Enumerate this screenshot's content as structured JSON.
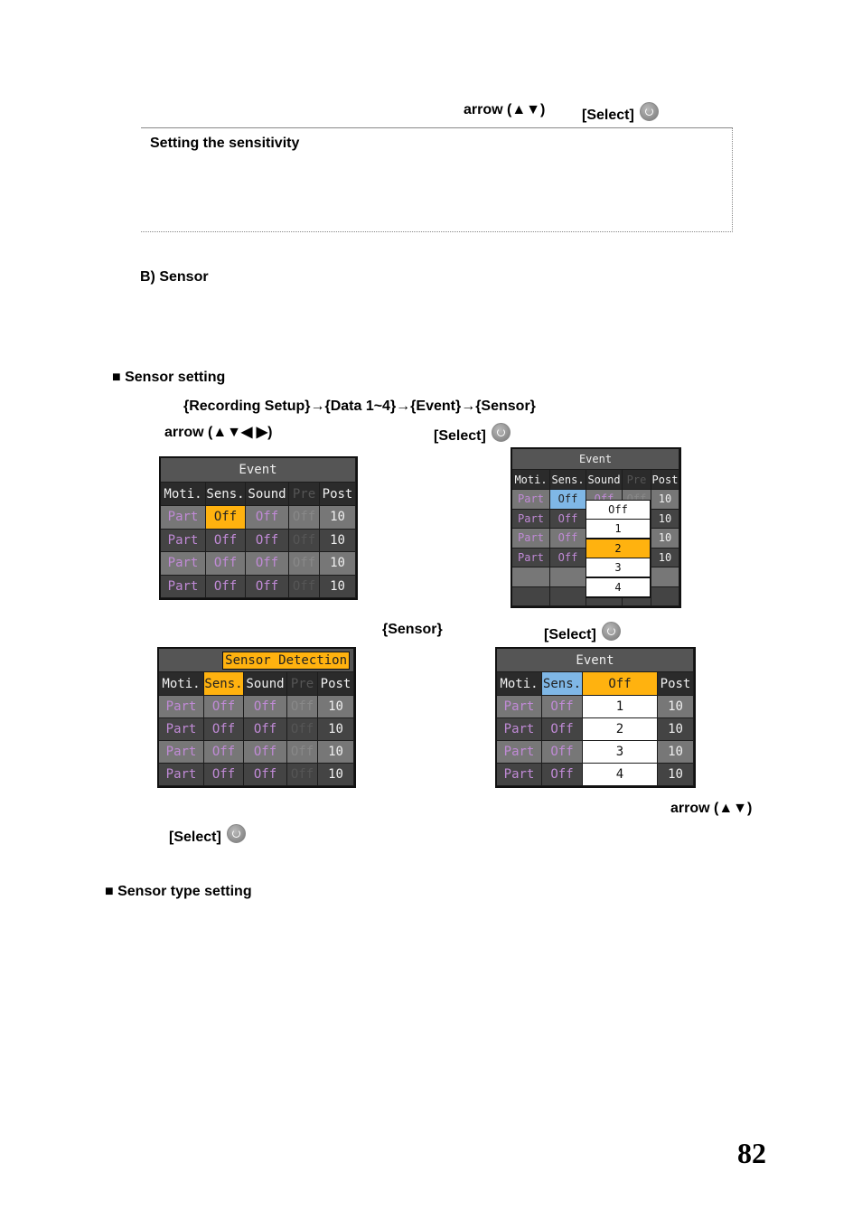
{
  "header": {
    "arrow": "arrow (▲▼)",
    "select": "[Select]"
  },
  "box_title": "Setting the sensitivity",
  "section_b": "B) Sensor",
  "sensor_setting": {
    "title": "■ Sensor setting",
    "path": "{Recording Setup}→{Data 1~4}→{Event}→{Sensor}",
    "arrow": "arrow (▲▼◀ ▶)",
    "select": "[Select]"
  },
  "mid": {
    "sensor": "{Sensor}",
    "select": "[Select]"
  },
  "bottom": {
    "arrow": "arrow (▲▼)",
    "select": "[Select]"
  },
  "sensor_type_title": "■ Sensor type setting",
  "page_number": "82",
  "colors": {
    "highlight": "#ffb20f",
    "selected_blue": "#7fb7e6",
    "part_text": "#c08ad6",
    "off_text": "#c08ad6"
  },
  "screens": [
    {
      "title": "Event",
      "headers": [
        "Moti.",
        "Sens.",
        "Sound",
        "Pre",
        "Post"
      ],
      "rows": [
        [
          "Part",
          "Off",
          "Off",
          "Off",
          "10"
        ],
        [
          "Part",
          "Off",
          "Off",
          "Off",
          "10"
        ],
        [
          "Part",
          "Off",
          "Off",
          "Off",
          "10"
        ],
        [
          "Part",
          "Off",
          "Off",
          "Off",
          "10"
        ]
      ],
      "highlight_cell": [
        0,
        1
      ]
    },
    {
      "title": "Event",
      "headers": [
        "Moti.",
        "Sens.",
        "Sound",
        "Pre",
        "Post"
      ],
      "rows": [
        [
          "Part",
          "Off",
          "Off",
          "Off",
          "10"
        ],
        [
          "Part",
          "Off",
          "Off",
          "Off",
          "10"
        ],
        [
          "Part",
          "Off",
          "Off",
          "Off",
          "10"
        ],
        [
          "Part",
          "Off",
          "Off",
          "Off",
          "10"
        ]
      ],
      "selected_cell": [
        0,
        1
      ],
      "dropdown": {
        "options": [
          "Off",
          "1",
          "2",
          "3",
          "4"
        ],
        "selected": "2"
      }
    },
    {
      "title": "Sensor Detection",
      "headers": [
        "Moti.",
        "Sens.",
        "Sound",
        "Pre",
        "Post"
      ],
      "rows": [
        [
          "Part",
          "Off",
          "Off",
          "Off",
          "10"
        ],
        [
          "Part",
          "Off",
          "Off",
          "Off",
          "10"
        ],
        [
          "Part",
          "Off",
          "Off",
          "Off",
          "10"
        ],
        [
          "Part",
          "Off",
          "Off",
          "Off",
          "10"
        ]
      ],
      "highlight_header": 1
    },
    {
      "title": "Event",
      "headers": [
        "Moti.",
        "Sens.",
        "Off",
        "Post"
      ],
      "rows": [
        [
          "Part",
          "Off",
          "1",
          "10"
        ],
        [
          "Part",
          "Off",
          "2",
          "10"
        ],
        [
          "Part",
          "Off",
          "3",
          "10"
        ],
        [
          "Part",
          "Off",
          "4",
          "10"
        ]
      ],
      "selected_header": 1
    }
  ]
}
